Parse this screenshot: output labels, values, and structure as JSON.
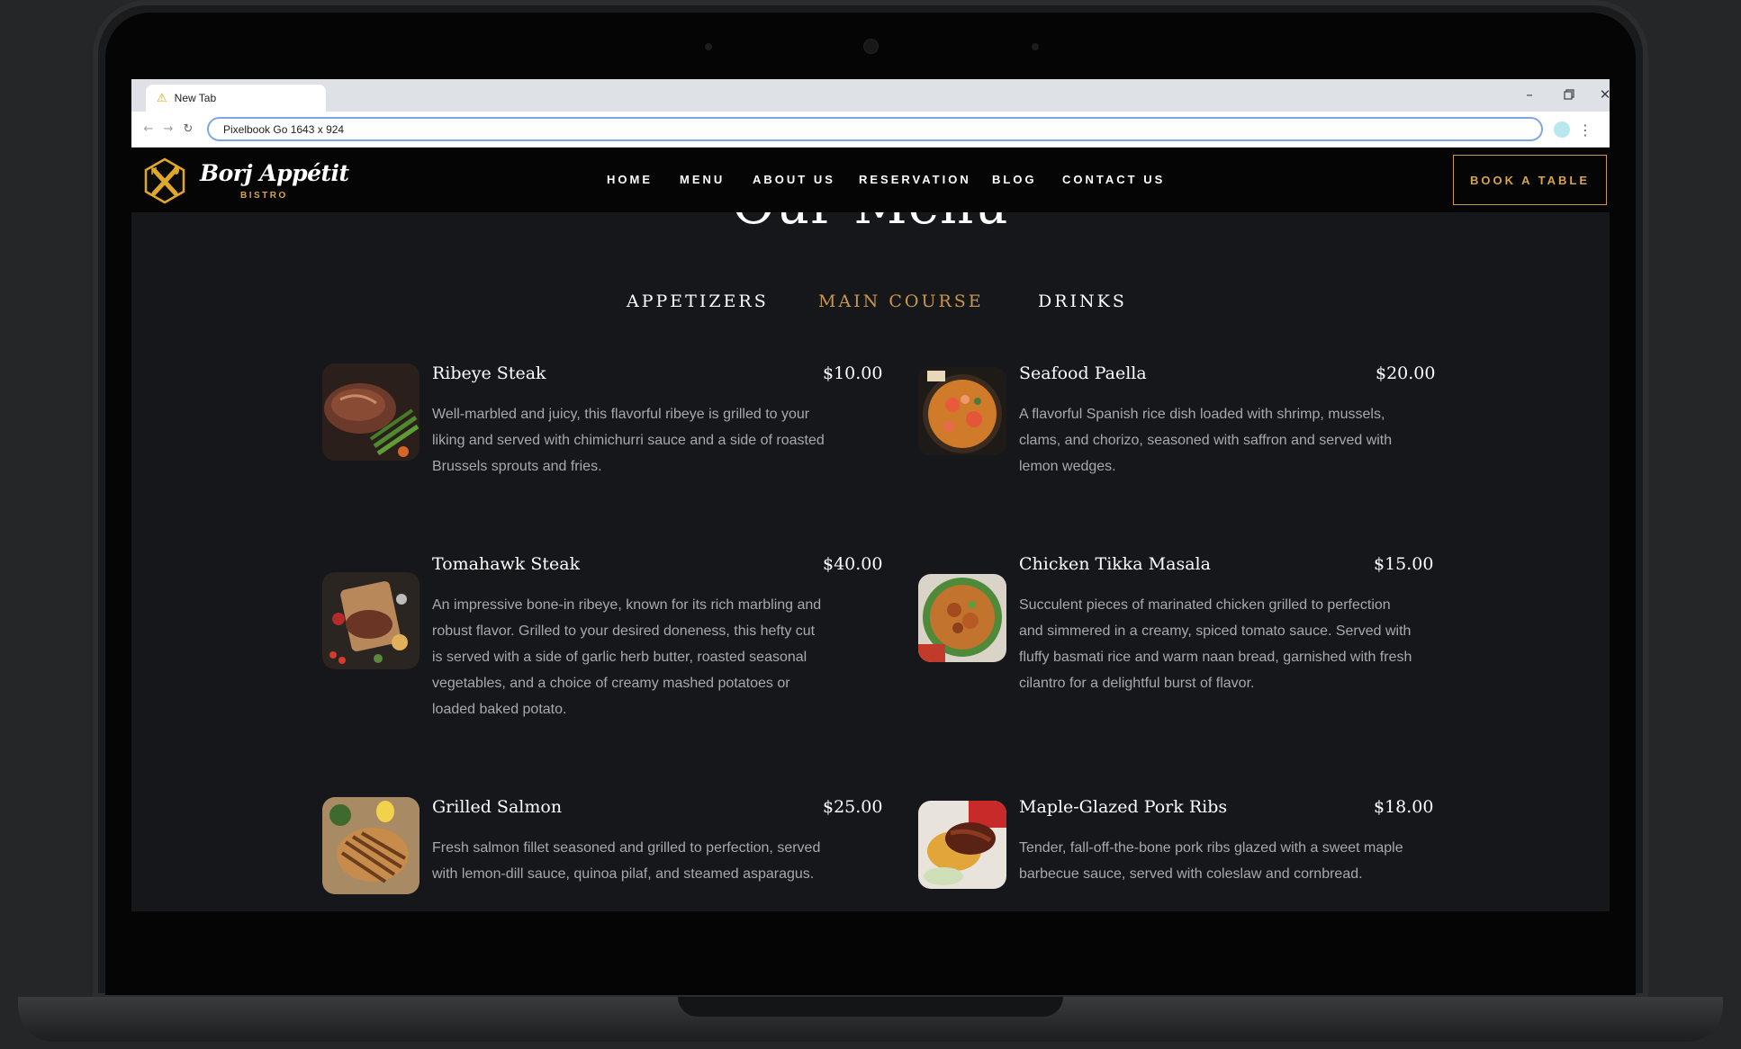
{
  "browser": {
    "tab_title": "New Tab",
    "address": "Pixelbook Go  1643 x 924",
    "tab_icon": "warning-icon",
    "profile_color": "#b9e7ee"
  },
  "site": {
    "brand_name": "Borj Appétit",
    "brand_sub": "BISTRO",
    "nav": [
      "HOME",
      "MENU",
      "ABOUT US",
      "RESERVATION",
      "BLOG",
      "CONTACT US"
    ],
    "cta": "BOOK A TABLE",
    "accent": "#d7a54a"
  },
  "menu": {
    "title": "Our Menu",
    "tabs": [
      "APPETIZERS",
      "MAIN COURSE",
      "DRINKS"
    ],
    "active_tab": "MAIN COURSE",
    "items": [
      {
        "name": "Ribeye Steak",
        "price": "$10.00",
        "desc": "Well-marbled and juicy, this flavorful ribeye is grilled to your liking and served with chimichurri sauce and a side of roasted Brussels sprouts and fries."
      },
      {
        "name": "Seafood Paella",
        "price": "$20.00",
        "desc": "A flavorful Spanish rice dish loaded with shrimp, mussels, clams, and chorizo, seasoned with saffron and served with lemon wedges."
      },
      {
        "name": "Tomahawk Steak",
        "price": "$40.00",
        "desc": "An impressive bone-in ribeye, known for its rich marbling and robust flavor. Grilled to your desired doneness, this hefty cut is served with a side of garlic herb butter, roasted seasonal vegetables, and a choice of creamy mashed potatoes or loaded baked potato."
      },
      {
        "name": "Chicken Tikka Masala",
        "price": "$15.00",
        "desc": "Succulent pieces of marinated chicken grilled to perfection and simmered in a creamy, spiced tomato sauce. Served with fluffy basmati rice and warm naan bread, garnished with fresh cilantro for a delightful burst of flavor."
      },
      {
        "name": "Grilled Salmon",
        "price": "$25.00",
        "desc": "Fresh salmon fillet seasoned and grilled to perfection, served with lemon-dill sauce, quinoa pilaf, and steamed asparagus."
      },
      {
        "name": "Maple-Glazed Pork Ribs",
        "price": "$18.00",
        "desc": "Tender, fall-off-the-bone pork ribs glazed with a sweet maple barbecue sauce, served with coleslaw and cornbread."
      }
    ]
  }
}
